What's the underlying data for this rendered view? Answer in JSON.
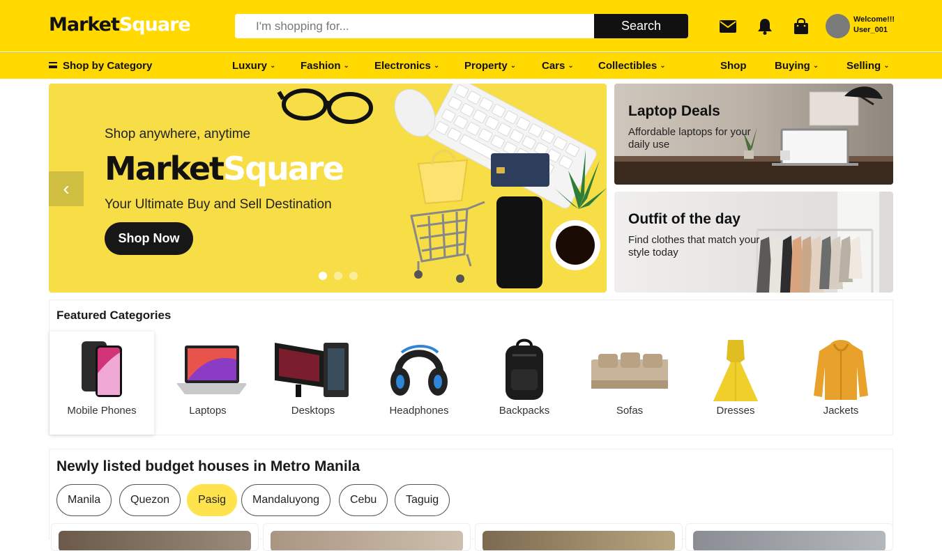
{
  "header": {
    "logo_part1": "Market",
    "logo_part2": "Square",
    "search_placeholder": "I'm shopping for...",
    "search_button": "Search",
    "welcome_line1": "Welcome!!!",
    "welcome_line2": "User_001",
    "icons": [
      "mail-icon",
      "bell-icon",
      "shopping-bag-icon"
    ]
  },
  "nav": {
    "shop_by_category": "Shop by Category",
    "categories": [
      "Luxury",
      "Fashion",
      "Electronics",
      "Property",
      "Cars",
      "Collectibles"
    ],
    "right_links": [
      "Shop",
      "Buying",
      "Selling"
    ]
  },
  "hero": {
    "subtitle": "Shop anywhere, anytime",
    "logo_part1": "Market",
    "logo_part2": "Square",
    "tagline": "Your Ultimate Buy and Sell Destination",
    "button": "Shop Now",
    "prev_glyph": "‹",
    "slide_count": 3,
    "active_slide": 1
  },
  "promos": [
    {
      "title": "Laptop Deals",
      "text": "Affordable laptops for your daily use"
    },
    {
      "title": "Outfit of the day",
      "text": "Find clothes that match your style today"
    }
  ],
  "featured": {
    "title": "Featured Categories",
    "items": [
      "Mobile Phones",
      "Laptops",
      "Desktops",
      "Headphones",
      "Backpacks",
      "Sofas",
      "Dresses",
      "Jackets"
    ]
  },
  "houses": {
    "title": "Newly listed budget houses in Metro Manila",
    "locations": [
      "Manila",
      "Quezon",
      "Pasig",
      "Mandaluyong",
      "Cebu",
      "Taguig"
    ],
    "active_location": "Pasig"
  },
  "colors": {
    "brand_yellow": "#ffd900",
    "dark": "#111111",
    "chip_active": "#ffe34d"
  }
}
